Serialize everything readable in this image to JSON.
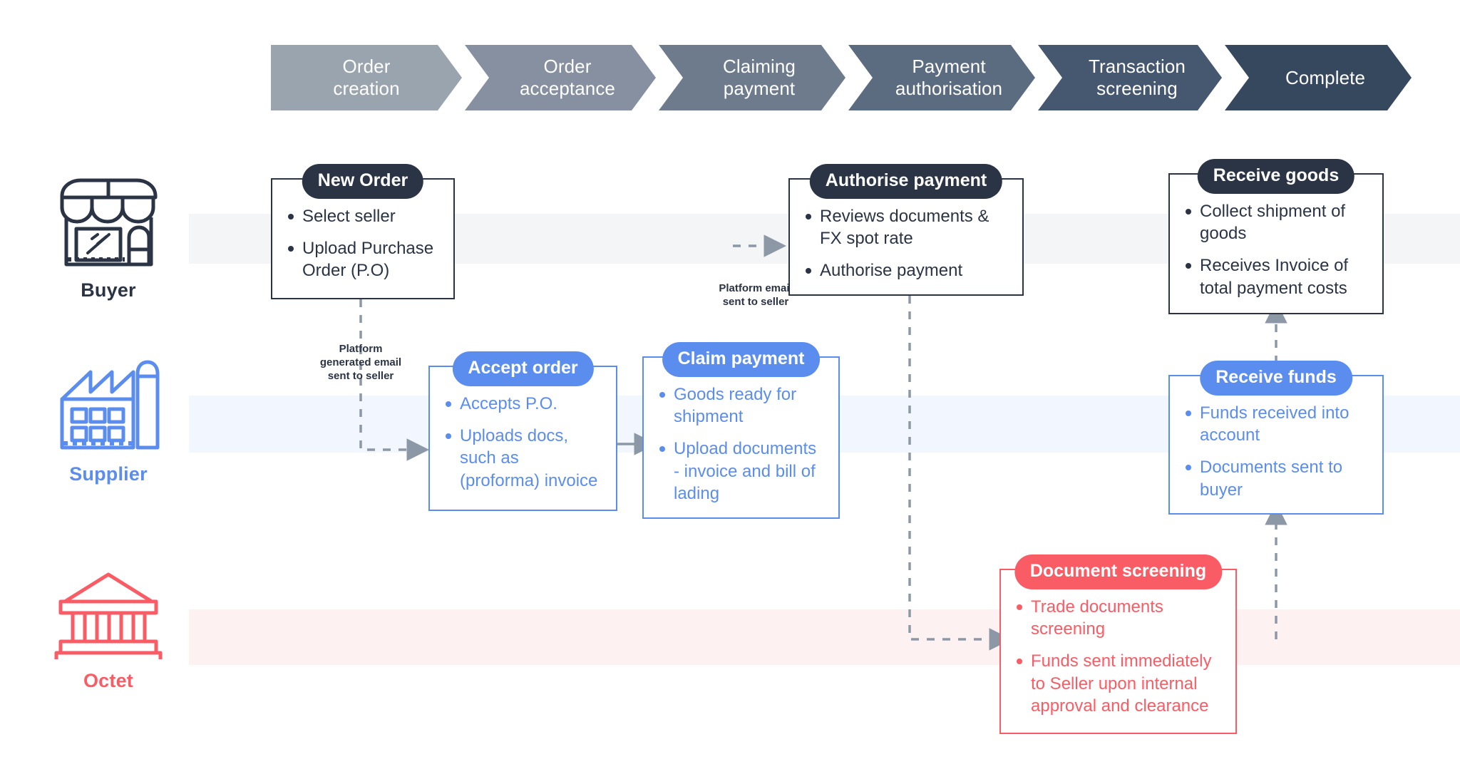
{
  "stages": [
    {
      "line1": "Order",
      "line2": "creation",
      "color": "#9aa4ae"
    },
    {
      "line1": "Order",
      "line2": "acceptance",
      "color": "#8690a0"
    },
    {
      "line1": "Claiming",
      "line2": "payment",
      "color": "#6d7b8d"
    },
    {
      "line1": "Payment",
      "line2": "authorisation",
      "color": "#5b6b80"
    },
    {
      "line1": "Transaction",
      "line2": "screening",
      "color": "#46586f"
    },
    {
      "line1": "Complete",
      "line2": "",
      "color": "#36485e"
    }
  ],
  "actors": [
    {
      "name": "Buyer",
      "icon": "storefront-icon",
      "color": "#2b3445"
    },
    {
      "name": "Supplier",
      "icon": "factory-icon",
      "color": "#5b8def"
    },
    {
      "name": "Octet",
      "icon": "bank-icon",
      "color": "#fa5c65"
    }
  ],
  "boxes": {
    "new_order": {
      "title": "New Order",
      "items": [
        "Select seller",
        "Upload Purchase Order (P.O)"
      ]
    },
    "accept_order": {
      "title": "Accept order",
      "items": [
        "Accepts P.O.",
        "Uploads docs, such as (proforma) invoice"
      ]
    },
    "claim_payment": {
      "title": "Claim payment",
      "items": [
        "Goods ready for shipment",
        "Upload documents - invoice and bill of lading"
      ]
    },
    "authorise_payment": {
      "title": "Authorise payment",
      "items": [
        "Reviews documents & FX spot rate",
        "Authorise payment"
      ]
    },
    "document_screening": {
      "title": "Document screening",
      "items": [
        "Trade documents screening",
        "Funds sent immediately to Seller upon internal approval and clearance"
      ]
    },
    "receive_funds": {
      "title": "Receive funds",
      "items": [
        "Funds received into account",
        "Documents sent to buyer"
      ]
    },
    "receive_goods": {
      "title": "Receive goods",
      "items": [
        "Collect shipment of goods",
        "Receives Invoice of total payment costs"
      ]
    }
  },
  "notes": {
    "platform_generated": "Platform generated email sent to seller",
    "platform_email": "Platform email sent to seller"
  },
  "colors": {
    "buyer": "#2b3445",
    "supplier": "#5b8def",
    "octet": "#fa5c65",
    "connector": "#8d98a7",
    "lane_buyer": "#f4f5f6",
    "lane_supplier": "#f2f6fe",
    "lane_octet": "#fdf1f2"
  }
}
